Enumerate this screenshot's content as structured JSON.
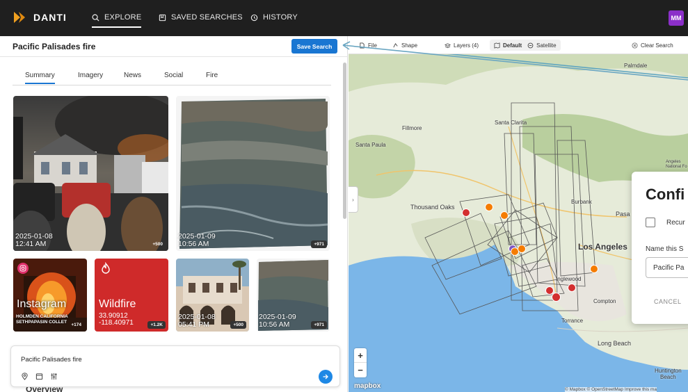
{
  "app": {
    "name": "DANTI",
    "user_initials": "MM"
  },
  "nav": {
    "explore": "EXPLORE",
    "saved": "SAVED SEARCHES",
    "history": "HISTORY"
  },
  "panel": {
    "title": "Pacific Palisades fire",
    "save_button": "Save Search",
    "tabs": [
      "Summary",
      "Imagery",
      "News",
      "Social",
      "Fire"
    ],
    "active_tab": "Summary"
  },
  "cards": {
    "photo1": {
      "date": "2025-01-08",
      "time": "12:41 AM",
      "count": "+500"
    },
    "sat1": {
      "date": "2025-01-09",
      "time": "10:56 AM",
      "count": "+971"
    },
    "instagram": {
      "label": "Instagram",
      "caption1": "HOLMDEN CALIFORNIA",
      "caption2": "SETHPAPASIN COLLET",
      "count": "+174"
    },
    "wildfire": {
      "label": "Wildfire",
      "lat": "33.90912",
      "lon": "-118.40971",
      "count": "+1.2K"
    },
    "photo2": {
      "date": "2025-01-08",
      "time": "05:41 PM",
      "count": "+500"
    },
    "sat2": {
      "date": "2025-01-09",
      "time": "10:56 AM",
      "count": "+971"
    }
  },
  "search": {
    "query": "Pacific Palisades fire"
  },
  "overview_label": "Overview",
  "map_toolbar": {
    "file": "File",
    "shape": "Shape",
    "layers": "Layers (4)",
    "default": "Default",
    "satellite": "Satellite",
    "clear": "Clear Search"
  },
  "map_labels": {
    "palmdale": "Palmdale",
    "santa_clarita": "Santa Clarita",
    "fillmore": "Fillmore",
    "santa_paula": "Santa Paula",
    "thousand_oaks": "Thousand Oaks",
    "burbank": "Burbank",
    "pasadena": "Pasa",
    "los_angeles": "Los Angeles",
    "inglewood": "Inglewood",
    "compton": "Compton",
    "torrance": "Torrance",
    "long_beach": "Long Beach",
    "huntington": "Huntington",
    "beach": "Beach",
    "angeles": "Angeles",
    "national_forest": "National Fo"
  },
  "map_footer": {
    "mapbox": "mapbox",
    "attribution": "© Mapbox © OpenStreetMap Improve this ma"
  },
  "dialog": {
    "title": "Confi",
    "recurring": "Recur",
    "name_label": "Name this S",
    "name_value": "Pacific Pa",
    "cancel": "CANCEL"
  },
  "colors": {
    "accent": "#1976d2",
    "fire_red": "#d32f2f",
    "instagram": "#e1306c",
    "marker_orange": "#f57c00"
  }
}
